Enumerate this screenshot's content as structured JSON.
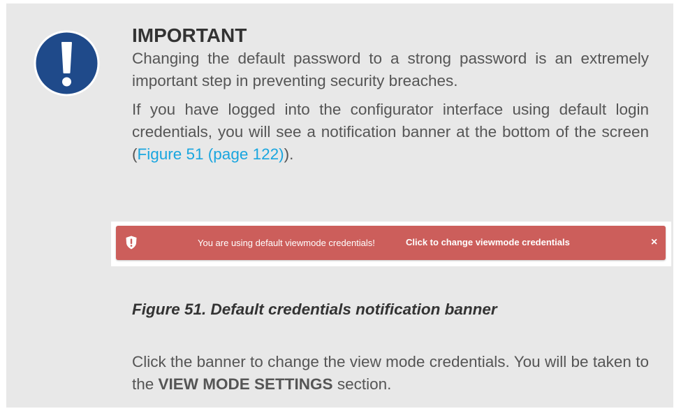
{
  "notice": {
    "heading": "IMPORTANT",
    "para1": "Changing the default password to a strong password is an extremely important step in preventing security breaches.",
    "para2_before": "If you have logged into the configurator interface using default login credentials, you will see a notification banner at the bottom of the screen (",
    "para2_link": "Figure 51 (page 122)",
    "para2_after": ")."
  },
  "banner": {
    "message": "You are using default viewmode credentials!",
    "action": "Click to change viewmode credentials",
    "close": "×",
    "icon": "shield-exclamation-icon",
    "color": "#cc5e5b"
  },
  "figure": {
    "caption": "Figure 51. Default credentials notification banner"
  },
  "closing": {
    "text_before": "Click the banner to change the view mode credentials. You will be taken to the ",
    "bold": "VIEW MODE SETTINGS",
    "text_after": " section."
  },
  "colors": {
    "panel_bg": "#e8e8e8",
    "icon_blue": "#1f4a8a",
    "link": "#1aa6df"
  }
}
